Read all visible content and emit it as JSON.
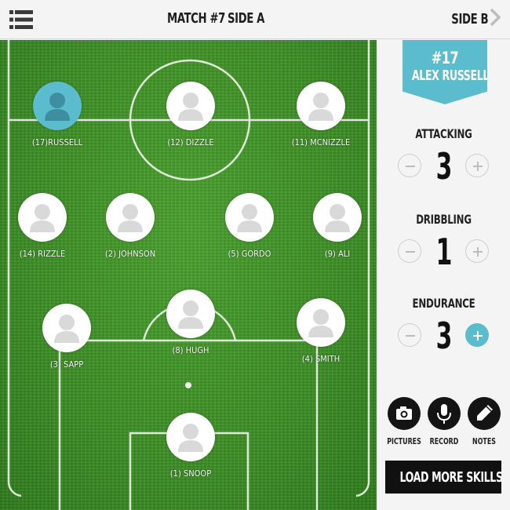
{
  "header": {
    "match_title": "MATCH #7",
    "side_a": "SIDE A",
    "side_b": "SIDE B",
    "menu_icon": "menu-icon",
    "chevron_icon": "chevron-right-icon"
  },
  "players": [
    {
      "label": "(17)RUSSELL",
      "selected": true
    },
    {
      "label": "(12) DIZZLE",
      "selected": false
    },
    {
      "label": "(11) MCNIZZLE",
      "selected": false
    },
    {
      "label": "(14) RIZZLE",
      "selected": false
    },
    {
      "label": "(2) JOHNSON",
      "selected": false
    },
    {
      "label": "(5) GORDO",
      "selected": false
    },
    {
      "label": "(9) ALI",
      "selected": false
    },
    {
      "label": "(3) SAPP",
      "selected": false
    },
    {
      "label": "(8) HUGH",
      "selected": false
    },
    {
      "label": "(4) SMITH",
      "selected": false
    },
    {
      "label": "(1) SNOOP",
      "selected": false
    }
  ],
  "selected_player": {
    "number": "#17",
    "name": "ALEX RUSSELL"
  },
  "skills": [
    {
      "label": "ATTACKING",
      "value": "3"
    },
    {
      "label": "DRIBBLING",
      "value": "1"
    },
    {
      "label": "ENDURANCE",
      "value": "3"
    }
  ],
  "tools": [
    {
      "label": "PICTURES",
      "icon": "camera-icon"
    },
    {
      "label": "RECORD",
      "icon": "microphone-icon"
    },
    {
      "label": "NOTES",
      "icon": "pencil-icon"
    }
  ],
  "load_more_label": "LOAD MORE SKILLS",
  "colors": {
    "accent": "#5bbccd",
    "pitch": "#3c8d25",
    "dark": "#141414"
  }
}
